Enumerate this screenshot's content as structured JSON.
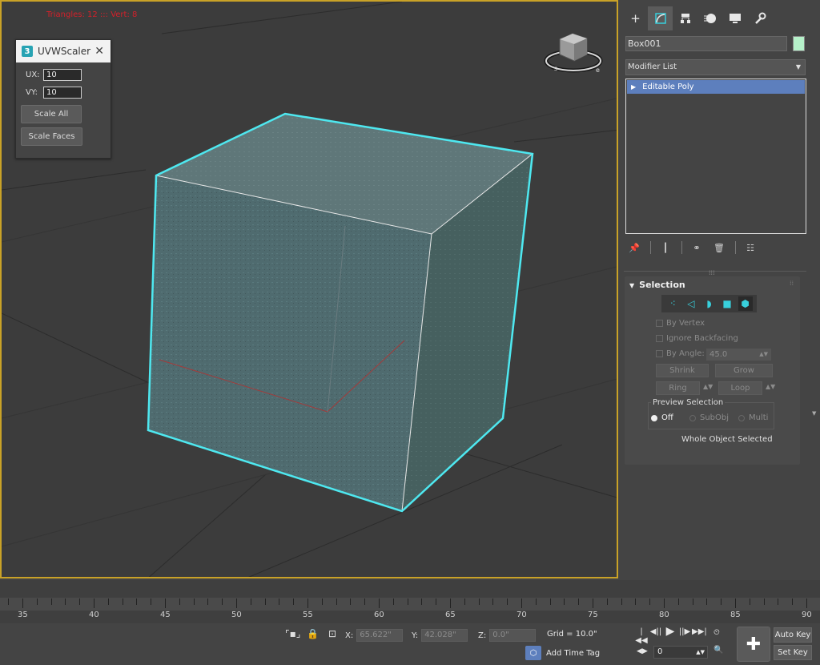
{
  "viewport": {
    "stats": "Triangles: 12 ::: Vert: 8"
  },
  "uvw_dialog": {
    "title": "UVWScaler",
    "ux_label": "UX:",
    "ux_value": "10",
    "vy_label": "VY:",
    "vy_value": "10",
    "scale_all": "Scale All",
    "scale_faces": "Scale Faces"
  },
  "command_panel": {
    "tabs": [
      "create-icon",
      "modify-icon",
      "hierarchy-icon",
      "motion-icon",
      "display-icon",
      "utilities-icon"
    ],
    "object_name": "Box001",
    "object_color": "#b5f1c9",
    "modifier_list": "Modifier List",
    "stack_items": [
      "Editable Poly"
    ]
  },
  "selection": {
    "title": "Selection",
    "by_vertex": "By Vertex",
    "ignore_backfacing": "Ignore Backfacing",
    "by_angle": "By Angle:",
    "angle_value": "45.0",
    "shrink": "Shrink",
    "grow": "Grow",
    "ring": "Ring",
    "loop": "Loop",
    "preview_selection": "Preview Selection",
    "off": "Off",
    "subobj": "SubObj",
    "multi": "Multi",
    "whole_object": "Whole Object Selected"
  },
  "timeline": {
    "labels": [
      "35",
      "40",
      "45",
      "50",
      "55",
      "60",
      "65",
      "70",
      "75",
      "80",
      "85",
      "90"
    ]
  },
  "status_bar": {
    "x_label": "X:",
    "x_value": "65.622\"",
    "y_label": "Y:",
    "y_value": "42.028\"",
    "z_label": "Z:",
    "z_value": "0.0\"",
    "grid": "Grid = 10.0\"",
    "add_time_tag": "Add Time Tag",
    "frame": "0",
    "auto_key": "Auto Key",
    "set_key": "Set Key"
  },
  "colors": {
    "accent": "#5d7fbd",
    "selection_outline": "#4ee8f0",
    "viewport_border": "#c9a227"
  }
}
